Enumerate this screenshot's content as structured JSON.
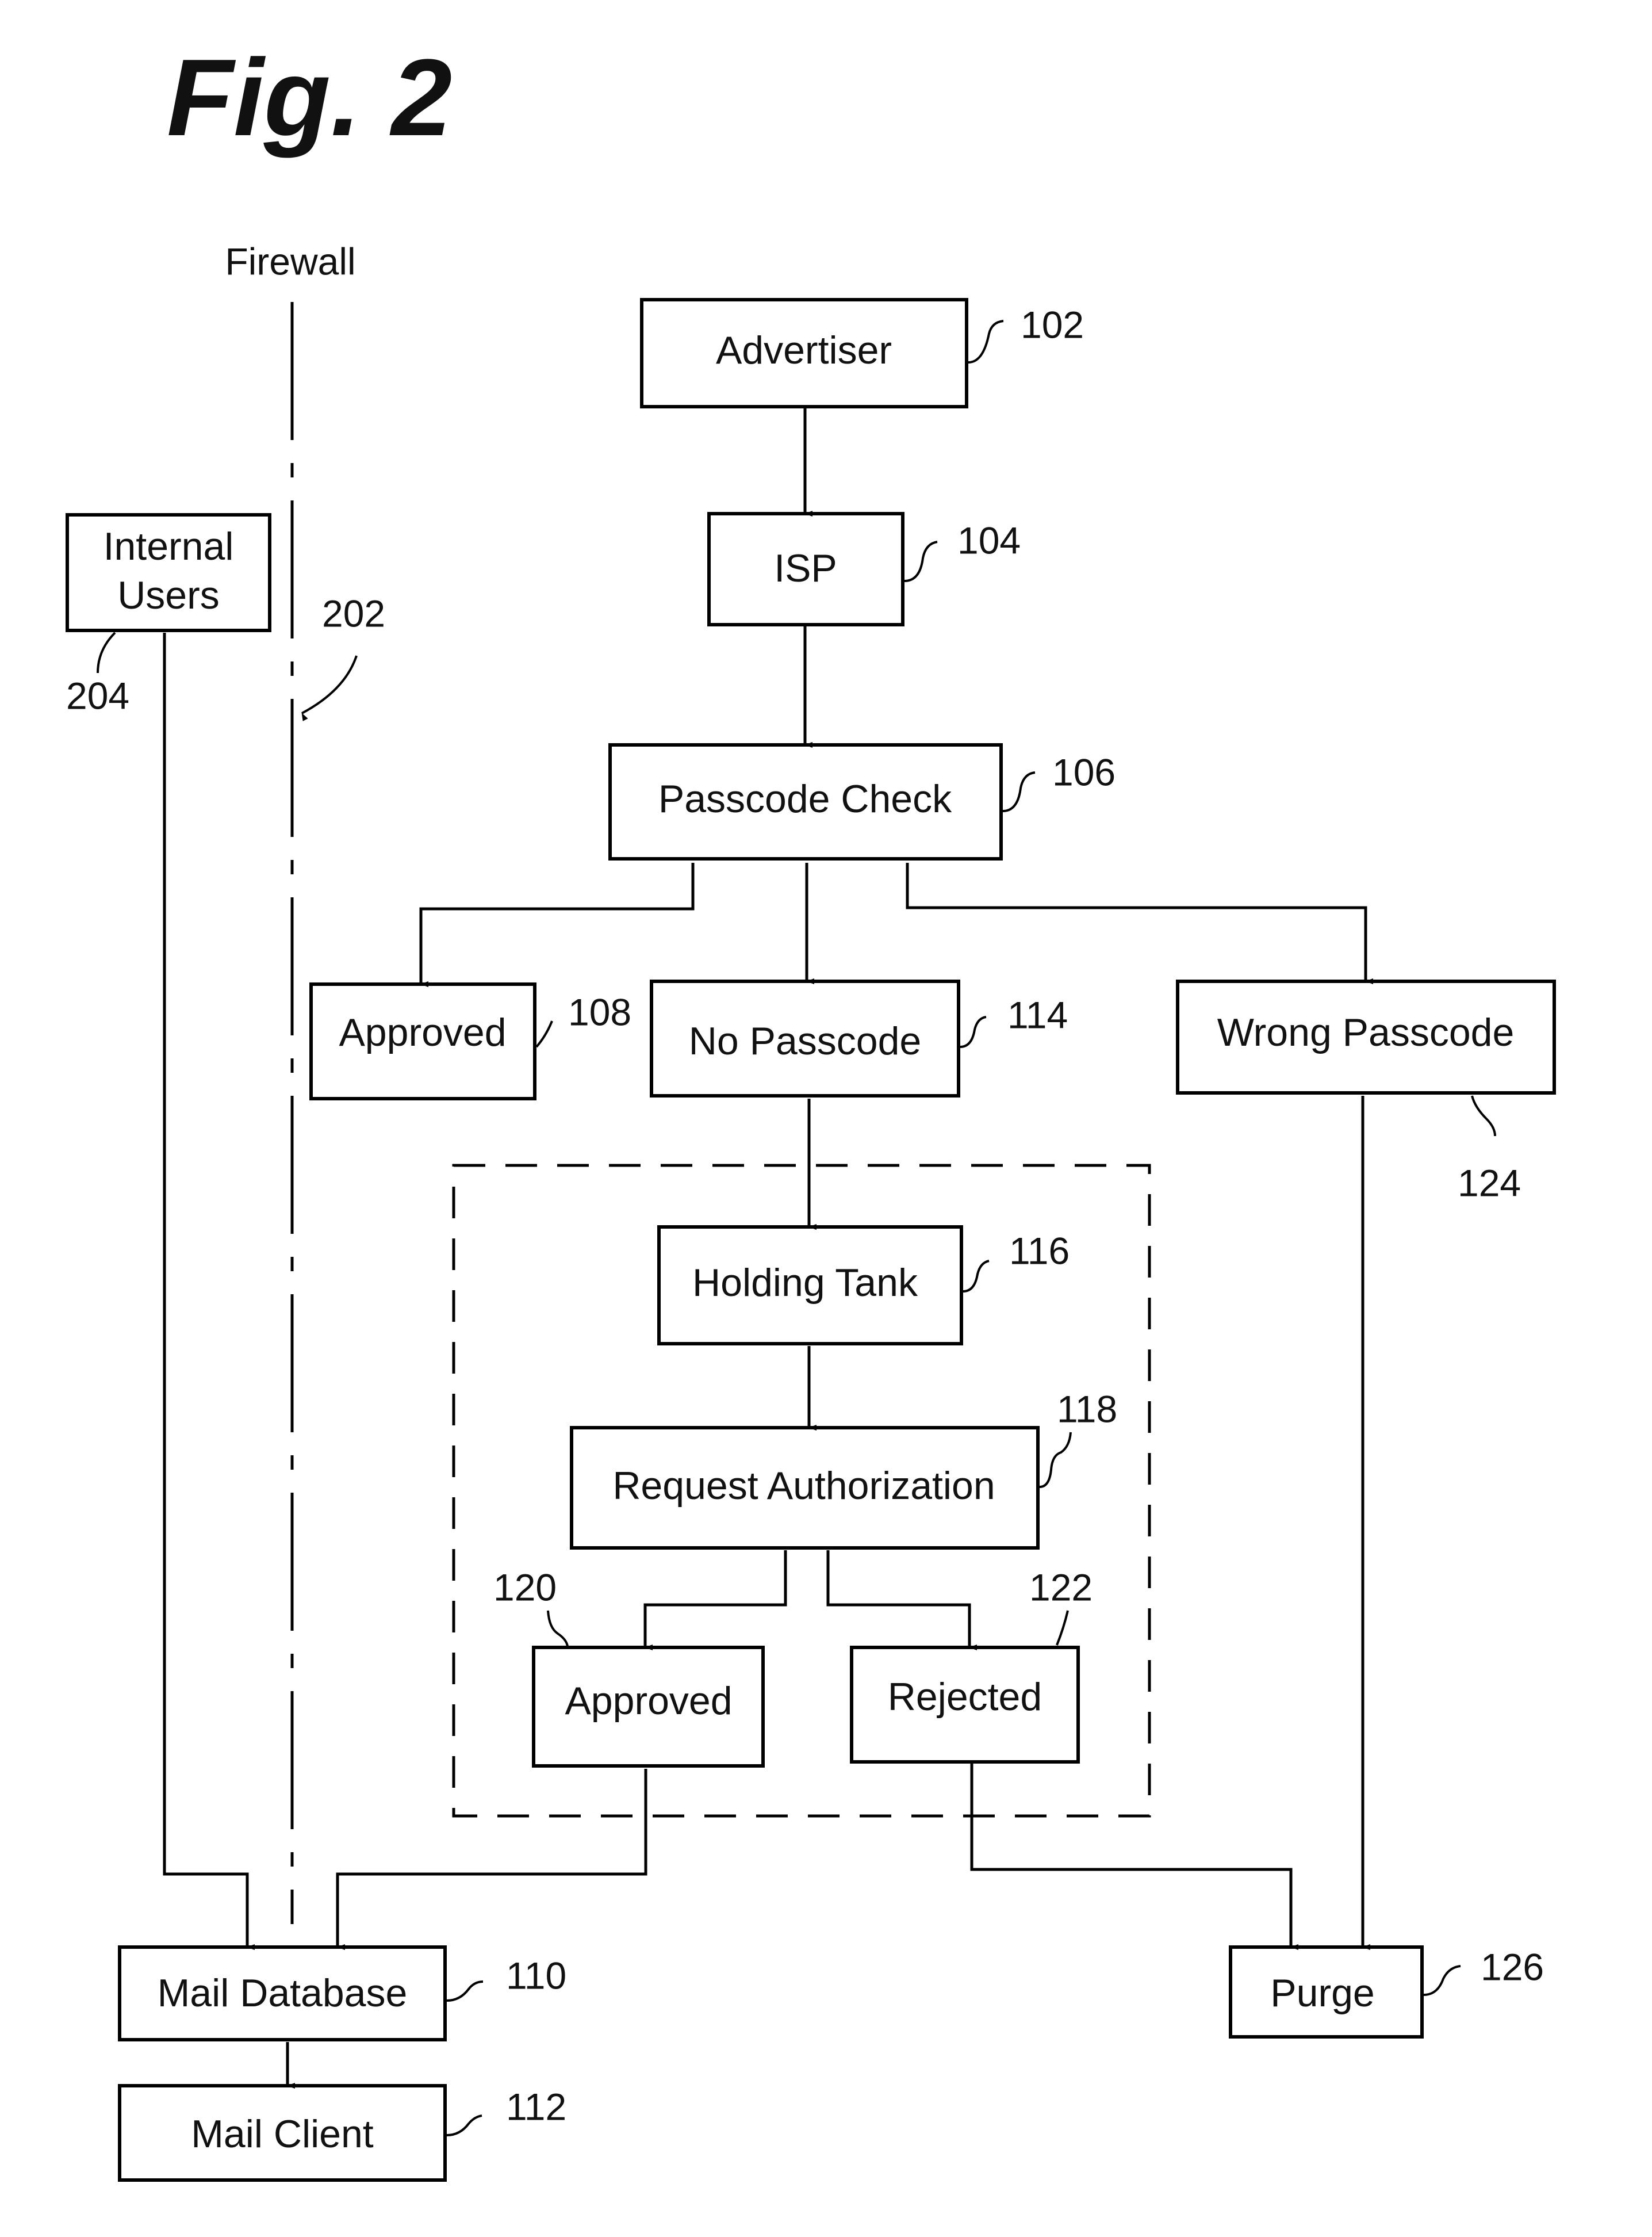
{
  "figure": {
    "title": "Fig. 2",
    "firewall_label": "Firewall"
  },
  "nodes": {
    "advertiser": {
      "label": "Advertiser",
      "ref": "102"
    },
    "isp": {
      "label": "ISP",
      "ref": "104"
    },
    "passcode_check": {
      "label": "Passcode Check",
      "ref": "106"
    },
    "approved_direct": {
      "label": "Approved",
      "ref": "108"
    },
    "no_passcode": {
      "label": "No Passcode",
      "ref": "114"
    },
    "wrong_passcode": {
      "label": "Wrong Passcode",
      "ref": "124"
    },
    "holding_tank": {
      "label": "Holding Tank",
      "ref": "116"
    },
    "request_authorization": {
      "label": "Request Authorization",
      "ref": "118"
    },
    "approved_after_request": {
      "label": "Approved",
      "ref": "120"
    },
    "rejected": {
      "label": "Rejected",
      "ref": "122"
    },
    "internal_users_line1": {
      "label": "Internal"
    },
    "internal_users_line2": {
      "label": "Users",
      "ref": "204"
    },
    "mail_database": {
      "label": "Mail Database",
      "ref": "110"
    },
    "mail_client": {
      "label": "Mail Client",
      "ref": "112"
    },
    "purge": {
      "label": "Purge",
      "ref": "126"
    },
    "firewall": {
      "ref": "202"
    }
  },
  "edges": [
    {
      "from": "Advertiser",
      "to": "ISP"
    },
    {
      "from": "ISP",
      "to": "Passcode Check"
    },
    {
      "from": "Passcode Check",
      "to": "Approved (108)"
    },
    {
      "from": "Passcode Check",
      "to": "No Passcode"
    },
    {
      "from": "Passcode Check",
      "to": "Wrong Passcode"
    },
    {
      "from": "No Passcode",
      "to": "Holding Tank"
    },
    {
      "from": "Holding Tank",
      "to": "Request Authorization"
    },
    {
      "from": "Request Authorization",
      "to": "Approved (120)"
    },
    {
      "from": "Request Authorization",
      "to": "Rejected"
    },
    {
      "from": "Internal Users",
      "to": "Mail Database"
    },
    {
      "from": "Approved (120)",
      "to": "Mail Database"
    },
    {
      "from": "Mail Database",
      "to": "Mail Client"
    },
    {
      "from": "Rejected",
      "to": "Purge"
    },
    {
      "from": "Wrong Passcode",
      "to": "Purge"
    }
  ]
}
